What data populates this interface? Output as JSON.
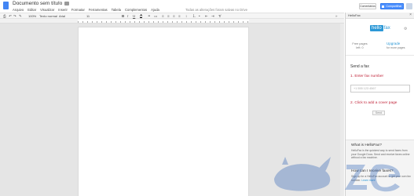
{
  "app": {
    "doc_title": "Documento sem título",
    "save_status": "Todas as alterações foram salvas no Drive"
  },
  "menu": [
    "Arquivo",
    "Editar",
    "Visualizar",
    "Inserir",
    "Formatar",
    "Ferramentas",
    "Tabela",
    "Complementos",
    "Ajuda"
  ],
  "header_buttons": {
    "comments": "Comentários",
    "share": "Compartilhar"
  },
  "toolbar": {
    "zoom": "100%",
    "style": "Texto normal",
    "font": "Arial",
    "size": "11",
    "text_color_label": "A",
    "more": "»"
  },
  "sidebar": {
    "title": "HelloFax",
    "close": "×",
    "logo_box": "hello",
    "logo_rest": "fax",
    "plan_line1": "Free pages",
    "plan_line2": "left: 0",
    "upgrade": "Upgrade",
    "upgrade_sub": "for more pages",
    "send_fax": "Send a fax",
    "step1": "1. Enter fax number",
    "fax_placeholder": "+1 555 123 4567",
    "step2": "2. Click to add a cover page",
    "send_btn": "Send",
    "what_title": "What is HelloFax?",
    "what_body": "HelloFax is the quickest way to send faxes from your Google Docs. Send and receive faxes online without a fax machine.",
    "how_title": "How can I receive faxes?",
    "how_body": "Sign up for a HelloFax account to get your own fax number.",
    "how_link": "Learn more"
  },
  "colors": {
    "accent": "#2c98d6",
    "share_blue": "#4d90fe",
    "step_red": "#c1263b",
    "canvas_gray": "#e5e5e5"
  }
}
